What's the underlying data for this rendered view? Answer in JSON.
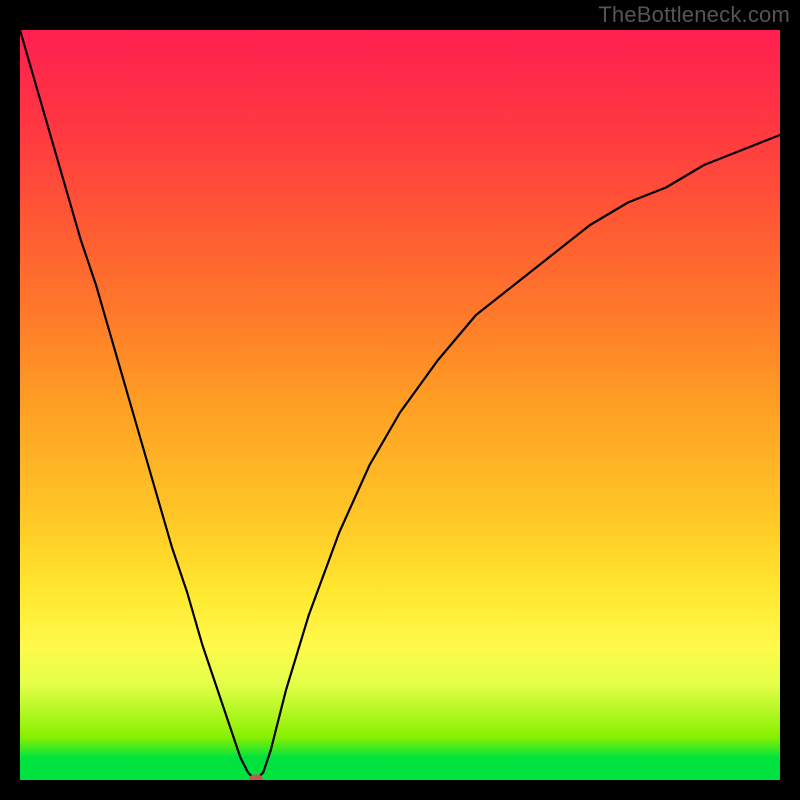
{
  "watermark": "TheBottleneck.com",
  "colors": {
    "frame": "#000000",
    "curve": "#000000",
    "marker": "#c05a50"
  },
  "chart_data": {
    "type": "line",
    "title": "",
    "xlabel": "",
    "ylabel": "",
    "xlim": [
      0,
      100
    ],
    "ylim": [
      0,
      100
    ],
    "x": [
      0,
      2,
      4,
      6,
      8,
      10,
      12,
      14,
      16,
      18,
      20,
      22,
      24,
      26,
      28,
      29,
      30,
      31,
      32,
      33,
      35,
      38,
      42,
      46,
      50,
      55,
      60,
      65,
      70,
      75,
      80,
      85,
      90,
      95,
      100
    ],
    "values": [
      100,
      93,
      86,
      79,
      72,
      66,
      59,
      52,
      45,
      38,
      31,
      25,
      18,
      12,
      6,
      3,
      1,
      0,
      1,
      4,
      12,
      22,
      33,
      42,
      49,
      56,
      62,
      66,
      70,
      74,
      77,
      79,
      82,
      84,
      86
    ],
    "marker": {
      "x": 31,
      "y": 0
    },
    "grid": false,
    "legend": false
  }
}
